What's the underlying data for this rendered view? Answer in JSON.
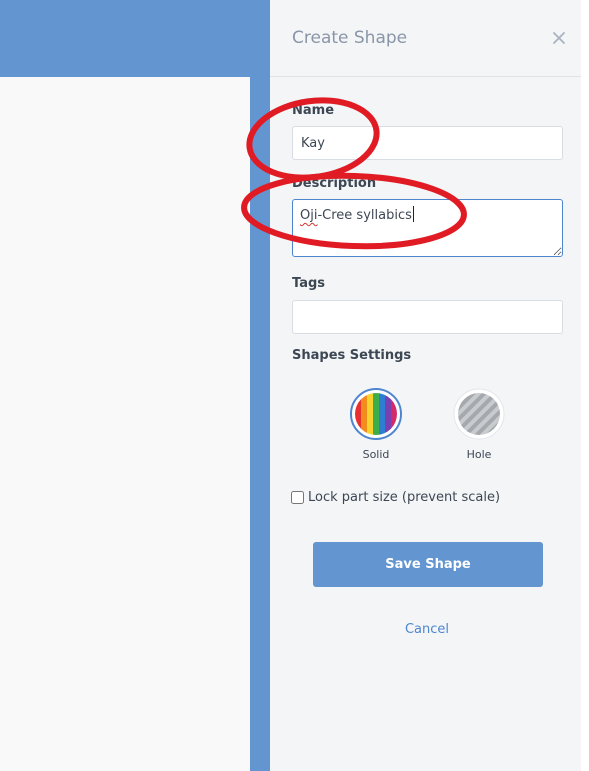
{
  "panel": {
    "title": "Create Shape",
    "close_icon": "close-icon"
  },
  "form": {
    "name_label": "Name",
    "name_value": "Kay",
    "description_label": "Description",
    "description_prefix_misspelled": "Oji",
    "description_rest": "-Cree syllabics",
    "tags_label": "Tags",
    "tags_value": "",
    "settings_label": "Shapes Settings"
  },
  "shape_options": [
    {
      "label": "Solid",
      "icon": "rainbow-solid-icon",
      "selected": true
    },
    {
      "label": "Hole",
      "icon": "striped-hole-icon",
      "selected": false
    }
  ],
  "lock": {
    "label": "Lock part size (prevent scale)",
    "checked": false
  },
  "actions": {
    "save_label": "Save Shape",
    "cancel_label": "Cancel"
  },
  "colors": {
    "accent": "#6395d0",
    "panel_bg": "#f3f5f7",
    "annotation": "#e01b24",
    "link": "#4d86cf"
  }
}
